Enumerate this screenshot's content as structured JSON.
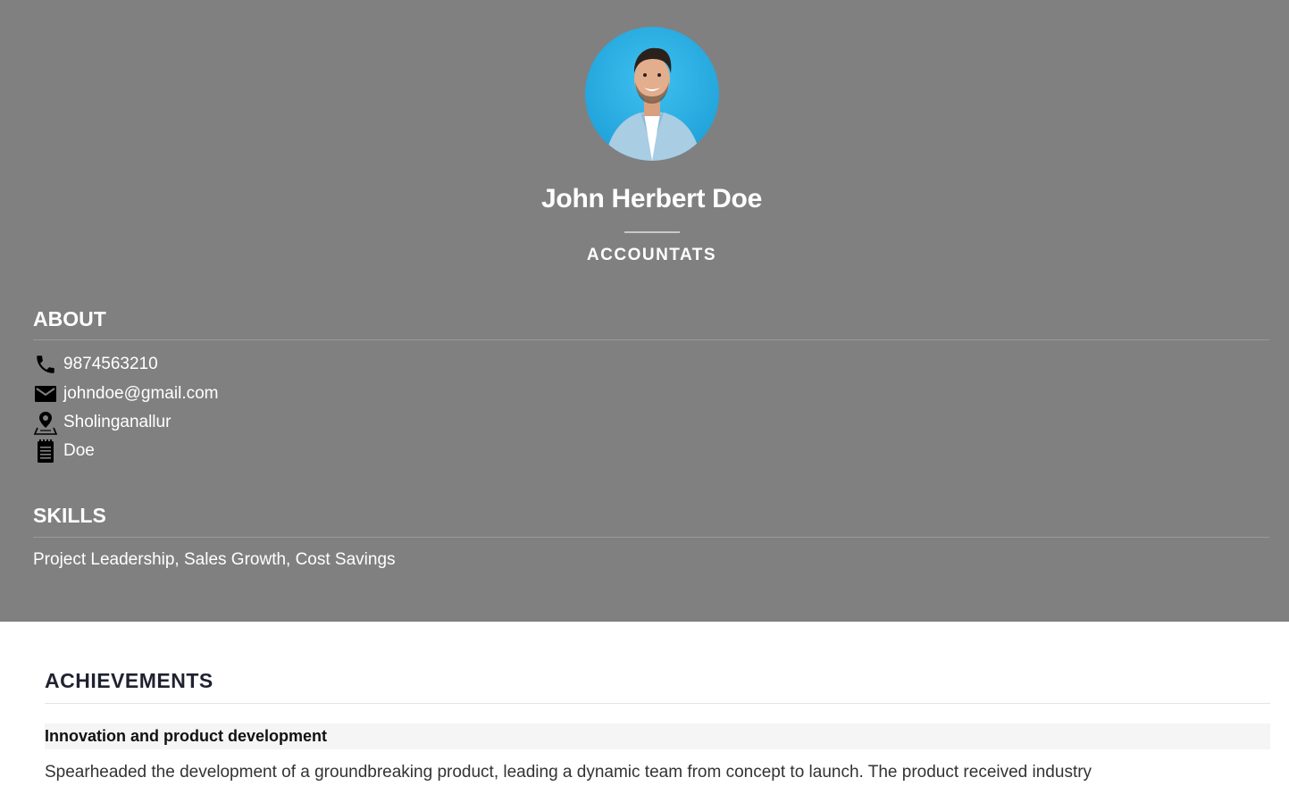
{
  "profile": {
    "name": "John Herbert Doe",
    "role": "ACCOUNTATS"
  },
  "about": {
    "title": "ABOUT",
    "items": [
      {
        "icon": "phone-icon",
        "text": "9874563210"
      },
      {
        "icon": "mail-icon",
        "text": "johndoe@gmail.com"
      },
      {
        "icon": "location-icon",
        "text": "Sholinganallur"
      },
      {
        "icon": "notepad-icon",
        "text": "Doe"
      }
    ]
  },
  "skills": {
    "title": "SKILLS",
    "text": "Project Leadership, Sales Growth, Cost Savings"
  },
  "achievements": {
    "title": "ACHIEVEMENTS",
    "items": [
      {
        "heading": "Innovation and product development",
        "body": "Spearheaded the development of a groundbreaking product, leading a dynamic team from concept to launch. The product received industry"
      }
    ]
  },
  "colors": {
    "header_bg": "#808080",
    "avatar_bg": "#29a9e1"
  }
}
